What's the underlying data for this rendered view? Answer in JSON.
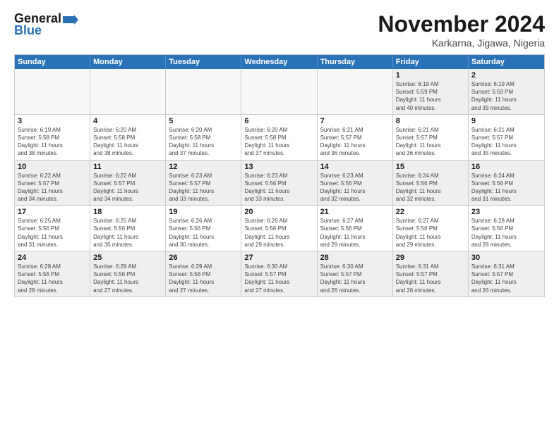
{
  "logo": {
    "line1": "General",
    "line2": "Blue",
    "arrow_unicode": "▶"
  },
  "title": "November 2024",
  "location": "Karkarna, Jigawa, Nigeria",
  "days_of_week": [
    "Sunday",
    "Monday",
    "Tuesday",
    "Wednesday",
    "Thursday",
    "Friday",
    "Saturday"
  ],
  "weeks": [
    [
      {
        "day": "",
        "info": ""
      },
      {
        "day": "",
        "info": ""
      },
      {
        "day": "",
        "info": ""
      },
      {
        "day": "",
        "info": ""
      },
      {
        "day": "",
        "info": ""
      },
      {
        "day": "1",
        "info": "Sunrise: 6:19 AM\nSunset: 5:59 PM\nDaylight: 11 hours\nand 40 minutes."
      },
      {
        "day": "2",
        "info": "Sunrise: 6:19 AM\nSunset: 5:59 PM\nDaylight: 11 hours\nand 39 minutes."
      }
    ],
    [
      {
        "day": "3",
        "info": "Sunrise: 6:19 AM\nSunset: 5:58 PM\nDaylight: 11 hours\nand 38 minutes."
      },
      {
        "day": "4",
        "info": "Sunrise: 6:20 AM\nSunset: 5:58 PM\nDaylight: 11 hours\nand 38 minutes."
      },
      {
        "day": "5",
        "info": "Sunrise: 6:20 AM\nSunset: 5:58 PM\nDaylight: 11 hours\nand 37 minutes."
      },
      {
        "day": "6",
        "info": "Sunrise: 6:20 AM\nSunset: 5:58 PM\nDaylight: 11 hours\nand 37 minutes."
      },
      {
        "day": "7",
        "info": "Sunrise: 6:21 AM\nSunset: 5:57 PM\nDaylight: 11 hours\nand 36 minutes."
      },
      {
        "day": "8",
        "info": "Sunrise: 6:21 AM\nSunset: 5:57 PM\nDaylight: 11 hours\nand 36 minutes."
      },
      {
        "day": "9",
        "info": "Sunrise: 6:21 AM\nSunset: 5:57 PM\nDaylight: 11 hours\nand 35 minutes."
      }
    ],
    [
      {
        "day": "10",
        "info": "Sunrise: 6:22 AM\nSunset: 5:57 PM\nDaylight: 11 hours\nand 34 minutes."
      },
      {
        "day": "11",
        "info": "Sunrise: 6:22 AM\nSunset: 5:57 PM\nDaylight: 11 hours\nand 34 minutes."
      },
      {
        "day": "12",
        "info": "Sunrise: 6:23 AM\nSunset: 5:57 PM\nDaylight: 11 hours\nand 33 minutes."
      },
      {
        "day": "13",
        "info": "Sunrise: 6:23 AM\nSunset: 5:56 PM\nDaylight: 11 hours\nand 33 minutes."
      },
      {
        "day": "14",
        "info": "Sunrise: 6:23 AM\nSunset: 5:56 PM\nDaylight: 11 hours\nand 32 minutes."
      },
      {
        "day": "15",
        "info": "Sunrise: 6:24 AM\nSunset: 5:56 PM\nDaylight: 11 hours\nand 32 minutes."
      },
      {
        "day": "16",
        "info": "Sunrise: 6:24 AM\nSunset: 5:56 PM\nDaylight: 11 hours\nand 31 minutes."
      }
    ],
    [
      {
        "day": "17",
        "info": "Sunrise: 6:25 AM\nSunset: 5:56 PM\nDaylight: 11 hours\nand 31 minutes."
      },
      {
        "day": "18",
        "info": "Sunrise: 6:25 AM\nSunset: 5:56 PM\nDaylight: 11 hours\nand 30 minutes."
      },
      {
        "day": "19",
        "info": "Sunrise: 6:26 AM\nSunset: 5:56 PM\nDaylight: 11 hours\nand 30 minutes."
      },
      {
        "day": "20",
        "info": "Sunrise: 6:26 AM\nSunset: 5:56 PM\nDaylight: 11 hours\nand 29 minutes."
      },
      {
        "day": "21",
        "info": "Sunrise: 6:27 AM\nSunset: 5:56 PM\nDaylight: 11 hours\nand 29 minutes."
      },
      {
        "day": "22",
        "info": "Sunrise: 6:27 AM\nSunset: 5:56 PM\nDaylight: 11 hours\nand 29 minutes."
      },
      {
        "day": "23",
        "info": "Sunrise: 6:28 AM\nSunset: 5:56 PM\nDaylight: 11 hours\nand 28 minutes."
      }
    ],
    [
      {
        "day": "24",
        "info": "Sunrise: 6:28 AM\nSunset: 5:56 PM\nDaylight: 11 hours\nand 28 minutes."
      },
      {
        "day": "25",
        "info": "Sunrise: 6:29 AM\nSunset: 5:56 PM\nDaylight: 11 hours\nand 27 minutes."
      },
      {
        "day": "26",
        "info": "Sunrise: 6:29 AM\nSunset: 5:56 PM\nDaylight: 11 hours\nand 27 minutes."
      },
      {
        "day": "27",
        "info": "Sunrise: 6:30 AM\nSunset: 5:57 PM\nDaylight: 11 hours\nand 27 minutes."
      },
      {
        "day": "28",
        "info": "Sunrise: 6:30 AM\nSunset: 5:57 PM\nDaylight: 11 hours\nand 26 minutes."
      },
      {
        "day": "29",
        "info": "Sunrise: 6:31 AM\nSunset: 5:57 PM\nDaylight: 11 hours\nand 26 minutes."
      },
      {
        "day": "30",
        "info": "Sunrise: 6:31 AM\nSunset: 5:57 PM\nDaylight: 11 hours\nand 26 minutes."
      }
    ]
  ]
}
